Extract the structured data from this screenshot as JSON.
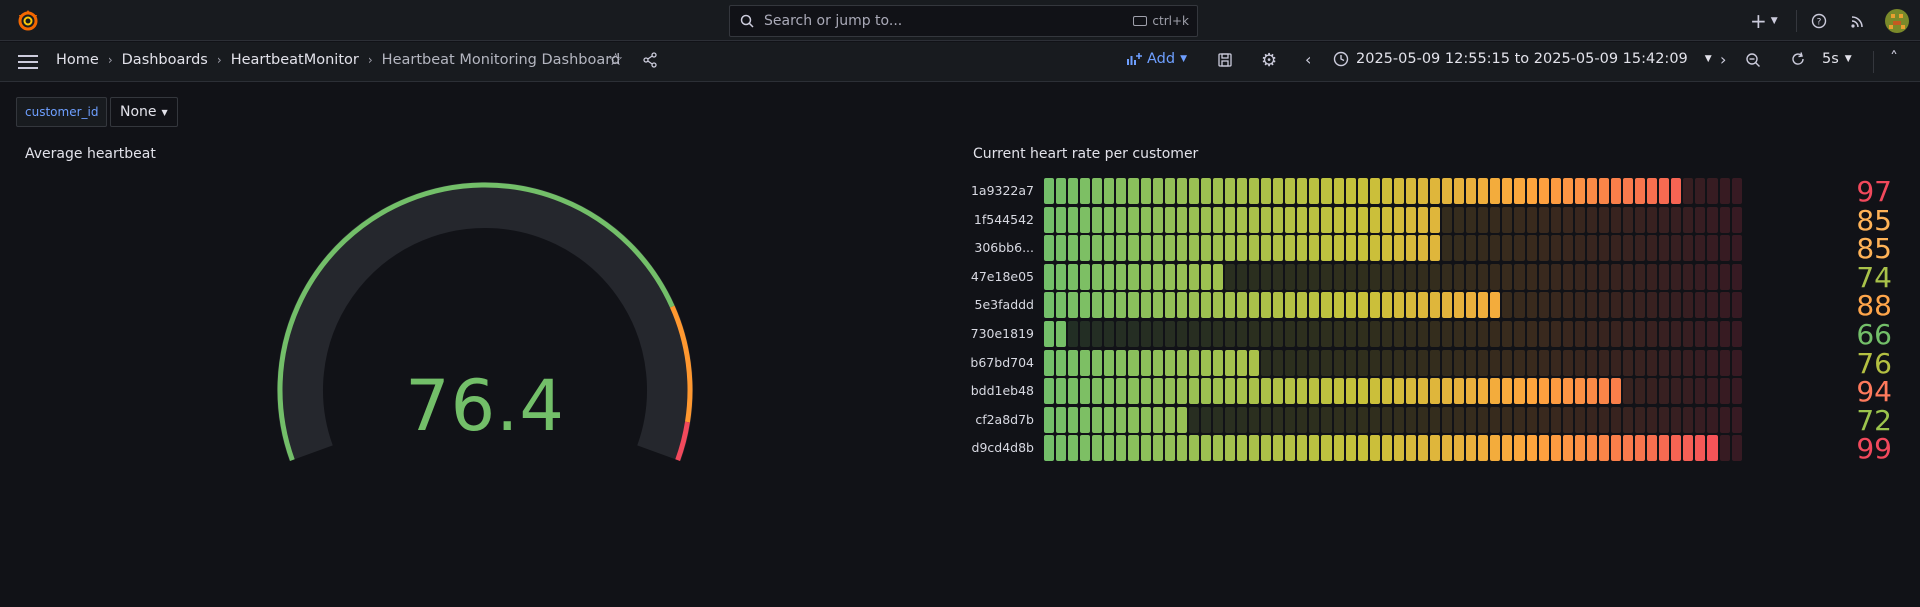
{
  "search": {
    "placeholder": "Search or jump to...",
    "shortcut": "ctrl+k"
  },
  "breadcrumb": {
    "home": "Home",
    "dashboards": "Dashboards",
    "folder": "HeartbeatMonitor",
    "current": "Heartbeat Monitoring Dashboard"
  },
  "toolbar": {
    "add_label": "Add",
    "time_range": "2025-05-09 12:55:15 to 2025-05-09 15:42:09",
    "refresh_interval": "5s"
  },
  "variables": {
    "name": "customer_id",
    "value": "None"
  },
  "gauge_panel": {
    "title": "Average heartbeat",
    "value": "76.4",
    "value_number": 76.4,
    "min": 0,
    "max": 100,
    "thresholds": [
      {
        "from": 0,
        "color": "#73bf69"
      },
      {
        "from": 80,
        "color": "#ff9830"
      },
      {
        "from": 95,
        "color": "#f2495c"
      }
    ]
  },
  "bargauge_panel": {
    "title": "Current heart rate per customer",
    "min": 0,
    "max": 100,
    "rows": [
      {
        "label": "1a9322a7",
        "value": "97",
        "num": 97,
        "color": "#f2495c"
      },
      {
        "label": "1f544542",
        "value": "85",
        "num": 85,
        "color": "#ffb357"
      },
      {
        "label": "306bb6...",
        "value": "85",
        "num": 85,
        "color": "#ffb357"
      },
      {
        "label": "47e18e05",
        "value": "74",
        "num": 74,
        "color": "#a9c24a"
      },
      {
        "label": "5e3faddd",
        "value": "88",
        "num": 88,
        "color": "#ffa54a"
      },
      {
        "label": "730e1819",
        "value": "66",
        "num": 66,
        "color": "#73bf69"
      },
      {
        "label": "b67bd704",
        "value": "76",
        "num": 76,
        "color": "#b4c042"
      },
      {
        "label": "bdd1eb48",
        "value": "94",
        "num": 94,
        "color": "#ff7a5c"
      },
      {
        "label": "cf2a8d7b",
        "value": "72",
        "num": 72,
        "color": "#9cc44d"
      },
      {
        "label": "d9cd4d8b",
        "value": "99",
        "num": 99,
        "color": "#f2495c"
      }
    ]
  }
}
